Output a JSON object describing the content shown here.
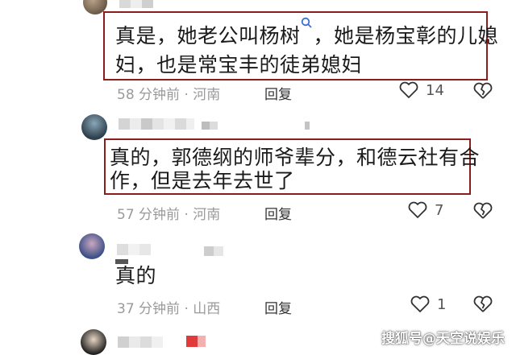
{
  "comments": [
    {
      "text_line1": "真是，她老公叫杨树",
      "text_line1b": "，她是杨宝彰的儿媳",
      "text_line2": "妇，也是常宝丰的徒弟媳妇",
      "time": "58 分钟前 · 河南",
      "reply_label": "回复",
      "likes": "14"
    },
    {
      "text_line1": "真的，郭德纲的师爷辈分，和德云社有合",
      "text_line2": "作，但是去年去世了",
      "time": "57 分钟前 · 河南",
      "reply_label": "回复",
      "likes": "7"
    },
    {
      "text_line1": "真的",
      "time": "37 分钟前 · 山西",
      "reply_label": "回复",
      "likes": "1"
    }
  ],
  "watermark": "搜狐号@天空说娱乐",
  "colors": {
    "highlight_box": "#8c1d1d",
    "meta": "#9a9a9a"
  }
}
